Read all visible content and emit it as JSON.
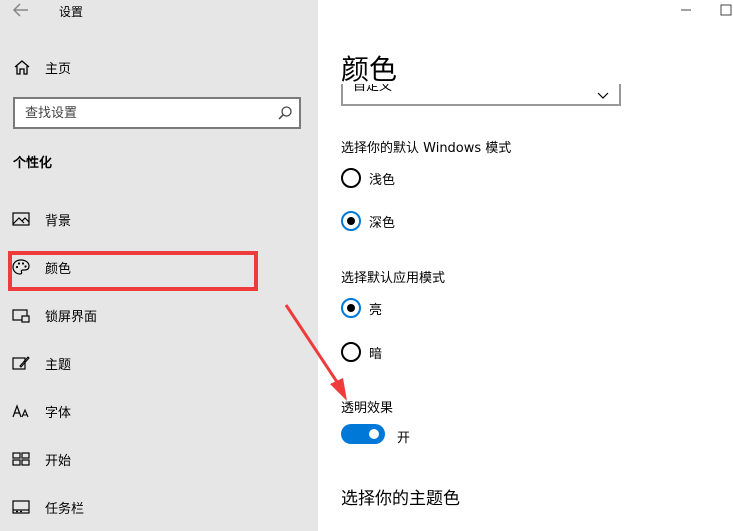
{
  "window": {
    "title": "设置"
  },
  "sidebar": {
    "home_label": "主页",
    "search": {
      "placeholder": "查找设置",
      "value": ""
    },
    "section_title": "个性化",
    "items": [
      {
        "label": "背景",
        "icon": "image-icon"
      },
      {
        "label": "颜色",
        "icon": "palette-icon"
      },
      {
        "label": "锁屏界面",
        "icon": "lock-screen-icon"
      },
      {
        "label": "主题",
        "icon": "theme-icon"
      },
      {
        "label": "字体",
        "icon": "font-icon"
      },
      {
        "label": "开始",
        "icon": "start-icon"
      },
      {
        "label": "任务栏",
        "icon": "taskbar-icon"
      }
    ]
  },
  "main": {
    "title": "颜色",
    "dropdown_value": "自定义",
    "windows_mode": {
      "label": "选择你的默认 Windows 模式",
      "options": [
        {
          "label": "浅色",
          "checked": false
        },
        {
          "label": "深色",
          "checked": true
        }
      ]
    },
    "app_mode": {
      "label": "选择默认应用模式",
      "options": [
        {
          "label": "亮",
          "checked": true
        },
        {
          "label": "暗",
          "checked": false
        }
      ]
    },
    "transparency": {
      "label": "透明效果",
      "state_label": "开",
      "on": true
    },
    "accent_heading": "选择你的主题色"
  },
  "colors": {
    "accent": "#0078d7",
    "annotation": "#ef3b3b",
    "sidebar_bg": "#e6e6e6"
  }
}
